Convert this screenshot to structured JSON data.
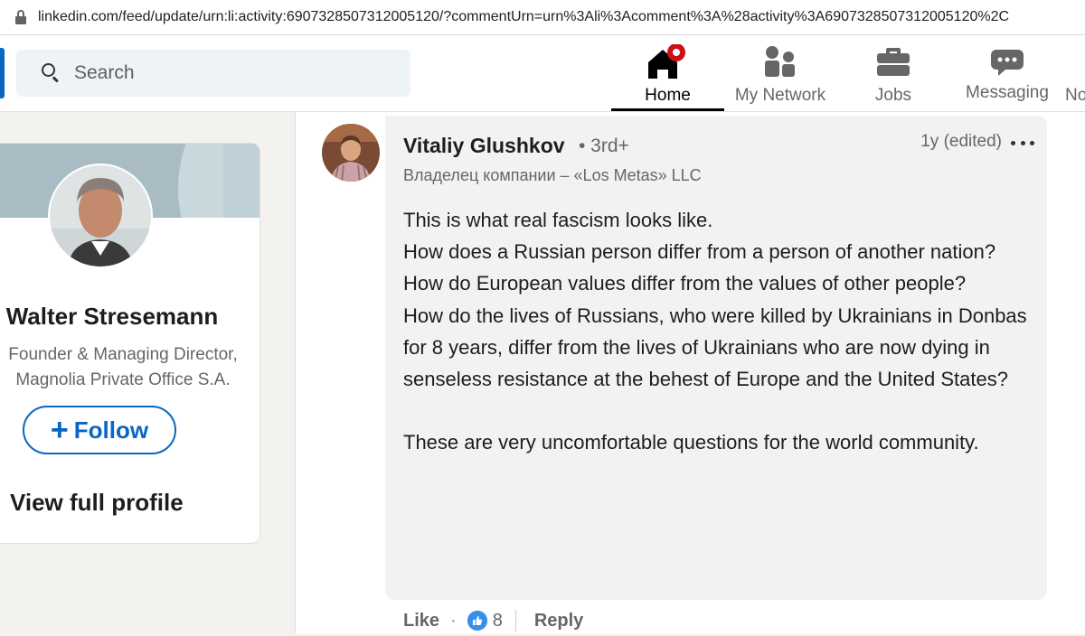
{
  "browser": {
    "url": "linkedin.com/feed/update/urn:li:activity:6907328507312005120/?commentUrn=urn%3Ali%3Acomment%3A%28activity%3A6907328507312005120%2C"
  },
  "header": {
    "search": {
      "placeholder": "Search"
    },
    "nav": [
      {
        "label": "Home",
        "icon": "home-icon",
        "active": true,
        "badge": true
      },
      {
        "label": "My Network",
        "icon": "network-icon"
      },
      {
        "label": "Jobs",
        "icon": "briefcase-icon"
      },
      {
        "label": "Messaging",
        "icon": "messaging-icon"
      },
      {
        "label": "No"
      }
    ]
  },
  "profile_card": {
    "name": "Walter Stresemann",
    "headline_line1": "Founder & Managing Director,",
    "headline_line2": "Magnolia Private Office S.A.",
    "follow_label": "Follow",
    "view_profile_label": "View full profile"
  },
  "comment": {
    "author": "Vitaliy Glushkov",
    "degree": "• 3rd+",
    "headline": "Владелец компании – «Los Metas» LLC",
    "time": "1y (edited)",
    "paragraphs": [
      "This is what real fascism looks like.",
      "How does a Russian person differ from a person of another nation?",
      "How do European values differ from the values of other people?",
      "How do the lives of Russians, who were killed by Ukrainians in Donbas for 8 years, differ from the lives of Ukrainians who are now dying in senseless resistance at the behest of Europe and the United States?",
      "",
      "These are very uncomfortable questions for the world community."
    ],
    "actions": {
      "like_label": "Like",
      "separator": "·",
      "reaction_count": "8",
      "reply_label": "Reply"
    }
  },
  "colors": {
    "accent": "#0a66c2",
    "notification": "#cc1016",
    "bubble": "#f2f2f2",
    "page_bg": "#f3f2ef"
  }
}
